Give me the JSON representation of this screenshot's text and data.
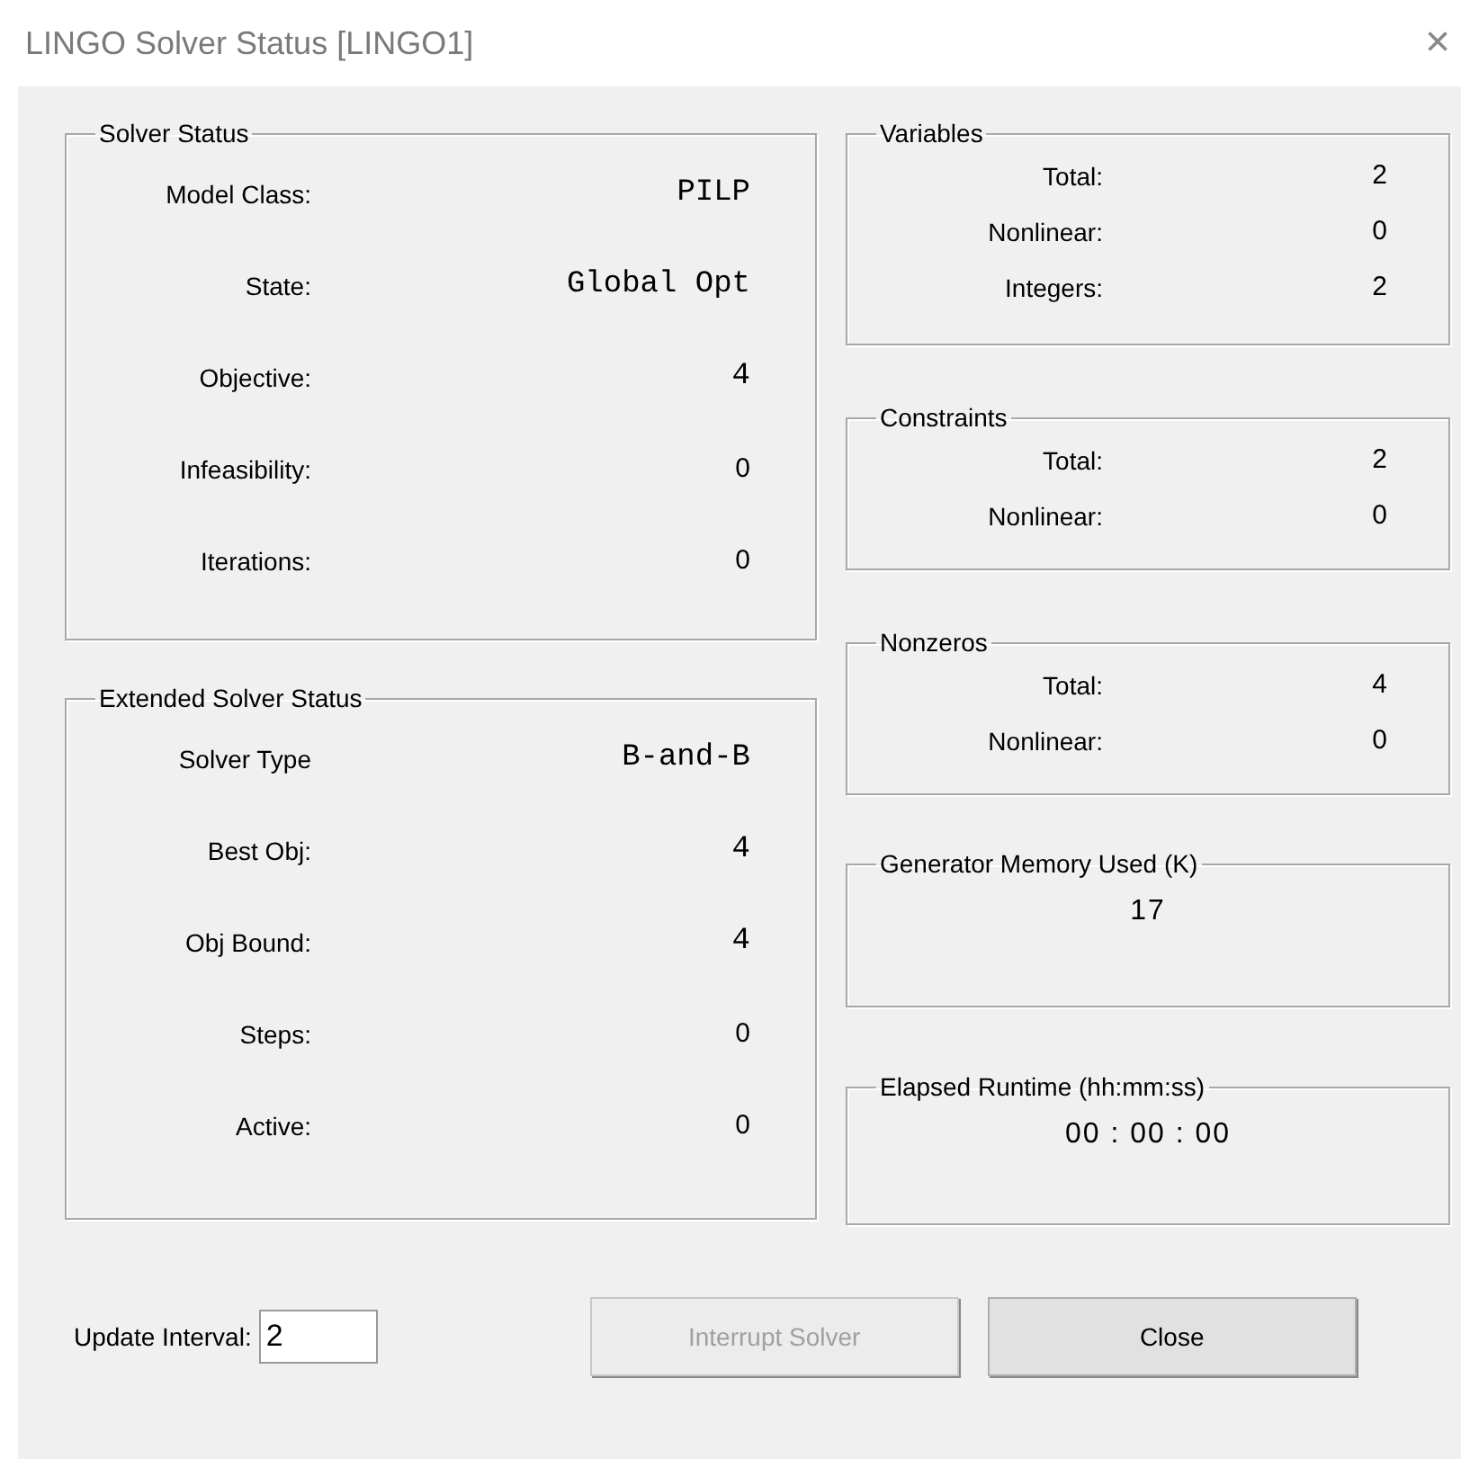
{
  "window": {
    "title": "LINGO Solver Status [LINGO1]",
    "close_glyph": "×"
  },
  "left_groups": [
    {
      "title": "Solver Status",
      "rows": [
        {
          "label": "Model Class:",
          "value": "PILP",
          "kind": "mono"
        },
        {
          "label": "State:",
          "value": "Global Opt",
          "kind": "mono"
        },
        {
          "label": "Objective:",
          "value": "4",
          "kind": "mono"
        },
        {
          "label": "Infeasibility:",
          "value": "0",
          "kind": "plain"
        },
        {
          "label": "Iterations:",
          "value": "0",
          "kind": "plain"
        }
      ]
    },
    {
      "title": "Extended Solver Status",
      "rows": [
        {
          "label": "Solver Type",
          "value": "B-and-B",
          "kind": "mono"
        },
        {
          "label": "Best Obj:",
          "value": "4",
          "kind": "mono"
        },
        {
          "label": "Obj Bound:",
          "value": "4",
          "kind": "mono"
        },
        {
          "label": "Steps:",
          "value": "0",
          "kind": "plain"
        },
        {
          "label": "Active:",
          "value": "0",
          "kind": "plain"
        }
      ]
    }
  ],
  "right_groups": [
    {
      "title": "Variables",
      "rows": [
        {
          "label": "Total:",
          "value": "2"
        },
        {
          "label": "Nonlinear:",
          "value": "0"
        },
        {
          "label": "Integers:",
          "value": "2"
        }
      ]
    },
    {
      "title": "Constraints",
      "rows": [
        {
          "label": "Total:",
          "value": "2"
        },
        {
          "label": "Nonlinear:",
          "value": "0"
        }
      ]
    },
    {
      "title": "Nonzeros",
      "rows": [
        {
          "label": "Total:",
          "value": "4"
        },
        {
          "label": "Nonlinear:",
          "value": "0"
        }
      ]
    },
    {
      "title": "Generator Memory Used (K)",
      "value": "17"
    },
    {
      "title": "Elapsed Runtime (hh:mm:ss)",
      "value": "00 : 00 : 00"
    }
  ],
  "update_interval": {
    "label": "Update Interval:",
    "value": "2"
  },
  "buttons": [
    {
      "label": "Interrupt Solver",
      "disabled": true
    },
    {
      "label": "Close",
      "disabled": false
    }
  ]
}
